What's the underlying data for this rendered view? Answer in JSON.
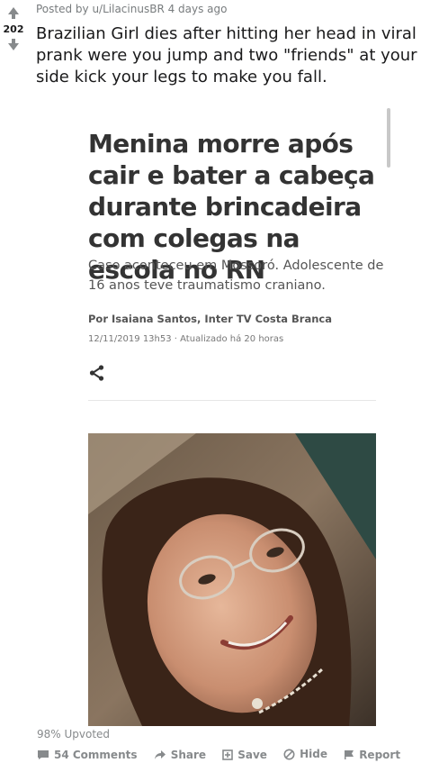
{
  "post": {
    "score": "202",
    "meta": "Posted by u/LilacinusBR 4 days ago",
    "title": "Brazilian Girl dies after hitting her head in viral prank were you jump and two \"friends\" at your side kick your legs to make you fall."
  },
  "article": {
    "headline": "Menina morre após cair e bater a cabeça durante brincadeira com colegas na escola no RN",
    "subhead": "Caso aconteceu em Mossoró. Adolescente de 16 anos teve traumatismo craniano.",
    "byline": "Por Isaiana Santos, Inter TV Costa Branca",
    "dateline": "12/11/2019 13h53 · Atualizado há 20 horas"
  },
  "footer": {
    "upvoted": "98% Upvoted",
    "comments_label": "54 Comments",
    "share_label": "Share",
    "save_label": "Save",
    "hide_label": "Hide",
    "report_label": "Report"
  },
  "icons": {
    "upvote": "upvote-arrow-icon",
    "downvote": "downvote-arrow-icon",
    "share_article": "share-icon",
    "comments": "comment-icon",
    "share": "share-arrow-icon",
    "save": "save-icon",
    "hide": "hide-icon",
    "report": "flag-icon"
  },
  "colors": {
    "meta_gray": "#878a8c",
    "headline": "#333333",
    "body": "#555555"
  }
}
